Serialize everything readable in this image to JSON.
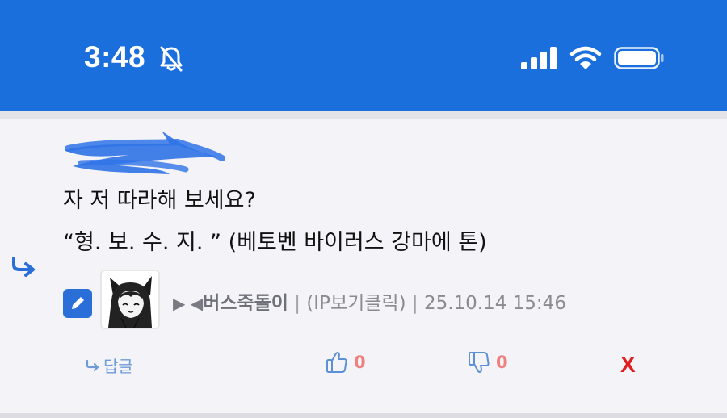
{
  "status_bar": {
    "time": "3:48",
    "icons": [
      "bell-muted-icon",
      "cellular-signal-icon",
      "wifi-icon",
      "battery-icon"
    ],
    "background": "#1a6fdc"
  },
  "comment": {
    "author_scribbled": true,
    "lines": [
      "자 저 따라해 보세요?",
      "“형. 보. 수. 지. ” (베토벤 바이러스 강마에 톤)"
    ]
  },
  "meta": {
    "marker": "▶ ◀",
    "nickname": "버스죽돌이",
    "separator": "|",
    "ip_link": "(IP보기클릭)",
    "timestamp": "25.10.14 15:46"
  },
  "actions": {
    "reply_label": "답글",
    "like_count": "0",
    "dislike_count": "0",
    "delete_label": "X"
  },
  "colors": {
    "accent": "#2a6fd8",
    "count": "#f08080",
    "delete": "#e02020",
    "reply": "#6f9ad8"
  }
}
